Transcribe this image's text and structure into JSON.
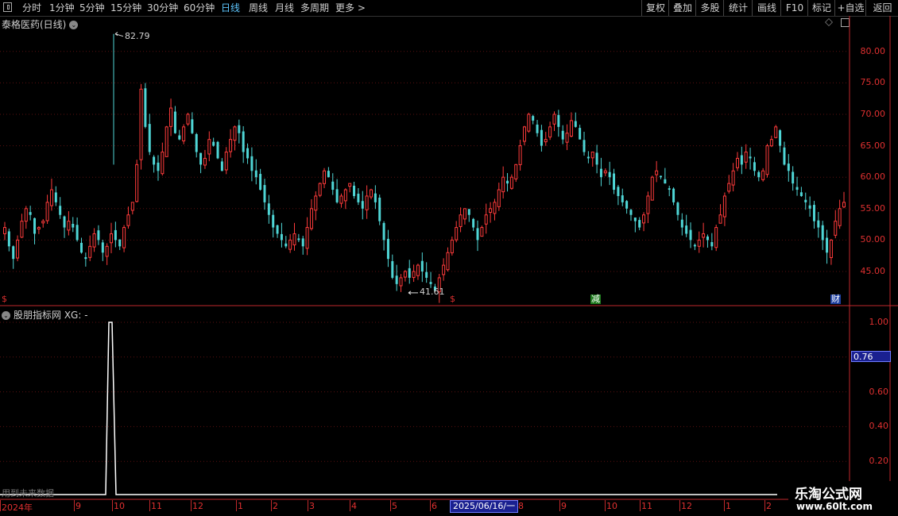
{
  "toolbar": {
    "periods": [
      "分时",
      "1分钟",
      "5分钟",
      "15分钟",
      "30分钟",
      "60分钟",
      "日线",
      "周线",
      "月线",
      "多周期",
      "更多 >"
    ],
    "active_period": "日线",
    "right_buttons": [
      "复权",
      "叠加",
      "多股",
      "统计",
      "画线",
      "F10",
      "标记",
      "+自选",
      "返回"
    ]
  },
  "main_panel": {
    "title": "泰格医药(日线)",
    "high_label": "82.79",
    "low_label": "41.61",
    "y_ticks": [
      "80.00",
      "75.00",
      "70.00",
      "65.00",
      "60.00",
      "55.00",
      "50.00",
      "45.00"
    ],
    "markers": [
      {
        "text": "$",
        "color": "#e03030"
      },
      {
        "text": "$",
        "color": "#e03030"
      },
      {
        "text": "减",
        "color": "#ffffff",
        "bg": "#1e7b1e"
      },
      {
        "text": "财",
        "color": "#ffffff",
        "bg": "#1d3fa0"
      }
    ]
  },
  "sub_panel": {
    "title": "股朋指标网 XG: -",
    "y_ticks": [
      "1.00",
      "0.60",
      "0.40",
      "0.20"
    ],
    "cursor_value": "0.76",
    "warning": "用到未来数据"
  },
  "date_axis": {
    "labels": [
      "2024年",
      "9",
      "10",
      "11",
      "12",
      "1",
      "2",
      "3",
      "4",
      "5",
      "6",
      "8",
      "9",
      "10",
      "11",
      "12",
      "1",
      "2"
    ],
    "cursor_date": "2025/06/16/一"
  },
  "watermark": {
    "line1": "乐淘公式网",
    "line2": "www.60lt.com"
  },
  "colors": {
    "up": "#ff3b3b",
    "down": "#4fd6d6",
    "axis": "#c0282b",
    "grid": "#5a1010",
    "indicator": "#ffffff"
  },
  "chart_data": {
    "type": "candlestick",
    "ylim": [
      41.61,
      82.79
    ],
    "closes": [
      52,
      49,
      47,
      50,
      53,
      55,
      54,
      51,
      52,
      53,
      56,
      58,
      56,
      54,
      52,
      53,
      52,
      50,
      48,
      47,
      49,
      51,
      50,
      48,
      49,
      51,
      50,
      49,
      52,
      54,
      56,
      62,
      74,
      68,
      64,
      62,
      61,
      64,
      68,
      71,
      67,
      66,
      68,
      70,
      67,
      64,
      62,
      63,
      66,
      65,
      63,
      61,
      64,
      66,
      68,
      67,
      64,
      63,
      61,
      60,
      58,
      56,
      54,
      52,
      51,
      50,
      49,
      50,
      51,
      50,
      49,
      52,
      55,
      57,
      59,
      61,
      60,
      58,
      56,
      57,
      58,
      59,
      57,
      56,
      55,
      57,
      58,
      56,
      53,
      50,
      47,
      44,
      43,
      44,
      45,
      44,
      45,
      46,
      45,
      44,
      43,
      42,
      44,
      46,
      48,
      50,
      52,
      54,
      55,
      54,
      52,
      50,
      52,
      54,
      55,
      56,
      58,
      60,
      59,
      60,
      62,
      65,
      68,
      70,
      69,
      67,
      65,
      66,
      68,
      70,
      68,
      66,
      67,
      69,
      68,
      66,
      64,
      63,
      64,
      62,
      60,
      61,
      60,
      58,
      57,
      56,
      55,
      54,
      53,
      52,
      54,
      57,
      60,
      61,
      60,
      59,
      58,
      56,
      54,
      52,
      51,
      50,
      49,
      50,
      51,
      50,
      49,
      52,
      54,
      57,
      59,
      61,
      63,
      62,
      64,
      63,
      61,
      60,
      61,
      65,
      66,
      68,
      65,
      62,
      61,
      59,
      58,
      57,
      56,
      55,
      53,
      52,
      50,
      48,
      50,
      53,
      55,
      56
    ]
  }
}
